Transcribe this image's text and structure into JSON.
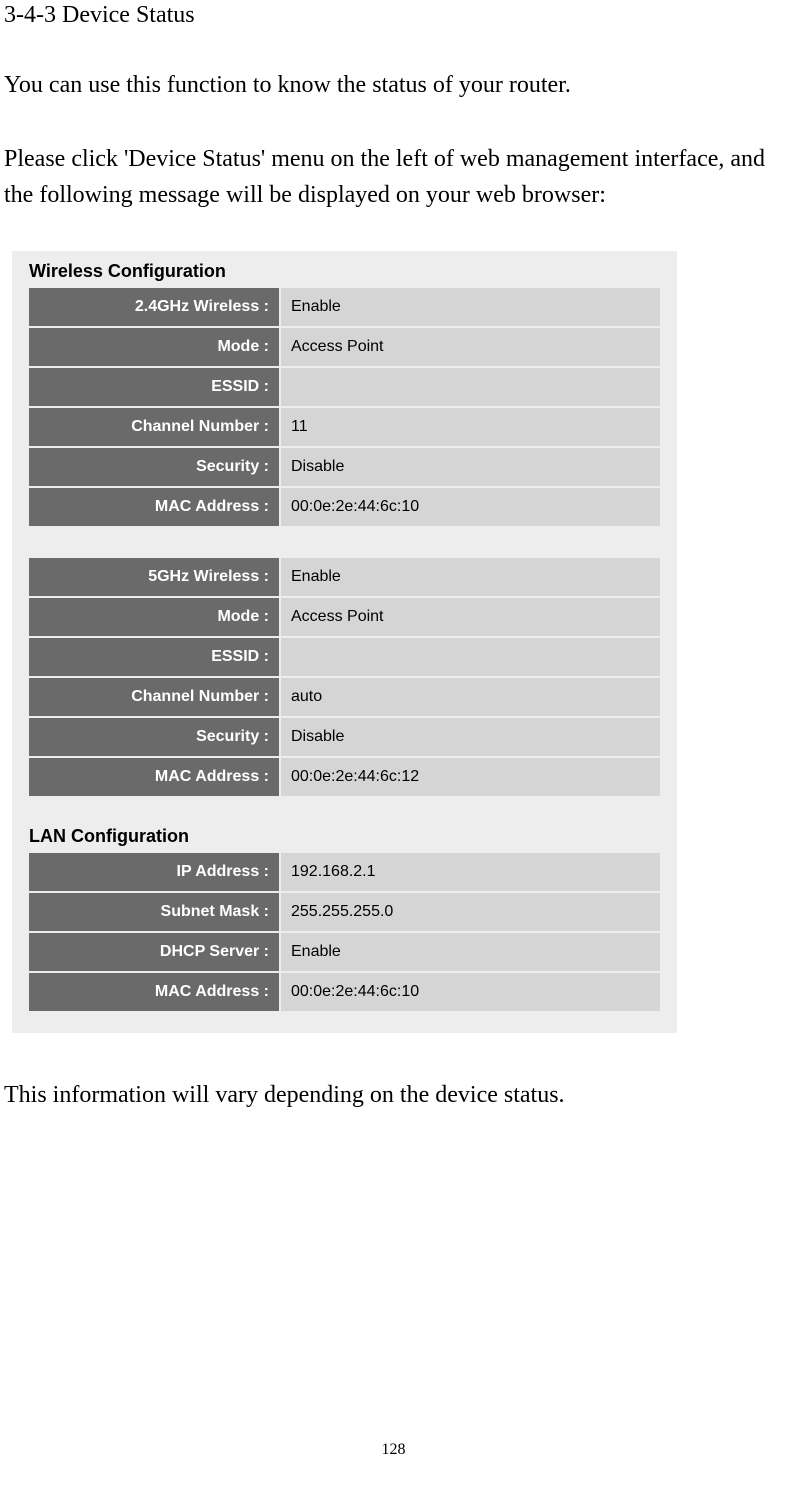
{
  "page": {
    "section_title": "3-4-3 Device Status",
    "intro": "You can use this function to know the status of your router.",
    "instruction": "Please click 'Device Status' menu on the left of web management interface, and the following message will be displayed on your web browser:",
    "closing": "This information will vary depending on the device status.",
    "page_number": "128"
  },
  "screenshot": {
    "wireless_header": "Wireless Configuration",
    "wireless_24": {
      "label_wireless": "2.4GHz Wireless :",
      "value_wireless": "Enable",
      "label_mode": "Mode :",
      "value_mode": "Access Point",
      "label_essid": "ESSID :",
      "value_essid": "",
      "label_channel": "Channel Number :",
      "value_channel": "11",
      "label_security": "Security :",
      "value_security": "Disable",
      "label_mac": "MAC Address :",
      "value_mac": "00:0e:2e:44:6c:10"
    },
    "wireless_5": {
      "label_wireless": "5GHz Wireless :",
      "value_wireless": "Enable",
      "label_mode": "Mode :",
      "value_mode": "Access Point",
      "label_essid": "ESSID :",
      "value_essid": "",
      "label_channel": "Channel Number :",
      "value_channel": "auto",
      "label_security": "Security :",
      "value_security": "Disable",
      "label_mac": "MAC Address :",
      "value_mac": "00:0e:2e:44:6c:12"
    },
    "lan_header": "LAN Configuration",
    "lan": {
      "label_ip": "IP Address :",
      "value_ip": "192.168.2.1",
      "label_subnet": "Subnet Mask :",
      "value_subnet": "255.255.255.0",
      "label_dhcp": "DHCP Server :",
      "value_dhcp": "Enable",
      "label_mac": "MAC Address :",
      "value_mac": "00:0e:2e:44:6c:10"
    }
  }
}
